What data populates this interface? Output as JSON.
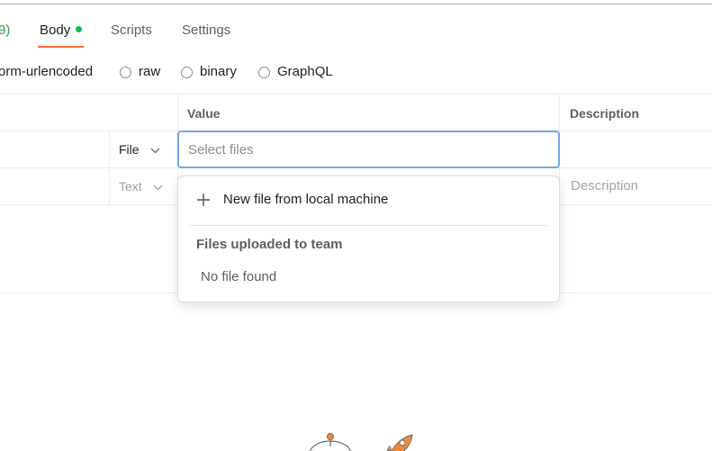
{
  "tabs": {
    "partial_label": "9)",
    "body_label": "Body",
    "scripts_label": "Scripts",
    "settings_label": "Settings"
  },
  "body_types": {
    "urlencoded_label": "orm-urlencoded",
    "raw_label": "raw",
    "binary_label": "binary",
    "graphql_label": "GraphQL"
  },
  "table": {
    "value_header": "Value",
    "description_header": "Description",
    "rows": [
      {
        "type": "File"
      },
      {
        "type": "Text",
        "description_placeholder": "Description"
      }
    ]
  },
  "value_input": {
    "placeholder": "Select files",
    "value": ""
  },
  "file_dropdown": {
    "new_file_label": "New file from local machine",
    "section_title": "Files uploaded to team",
    "empty_message": "No file found"
  },
  "colors": {
    "active_tab_indicator": "#ff6c37",
    "status_dot": "#0cbb52",
    "focus_border": "#74a7e6",
    "illustration_accent": "#f08a3a"
  }
}
